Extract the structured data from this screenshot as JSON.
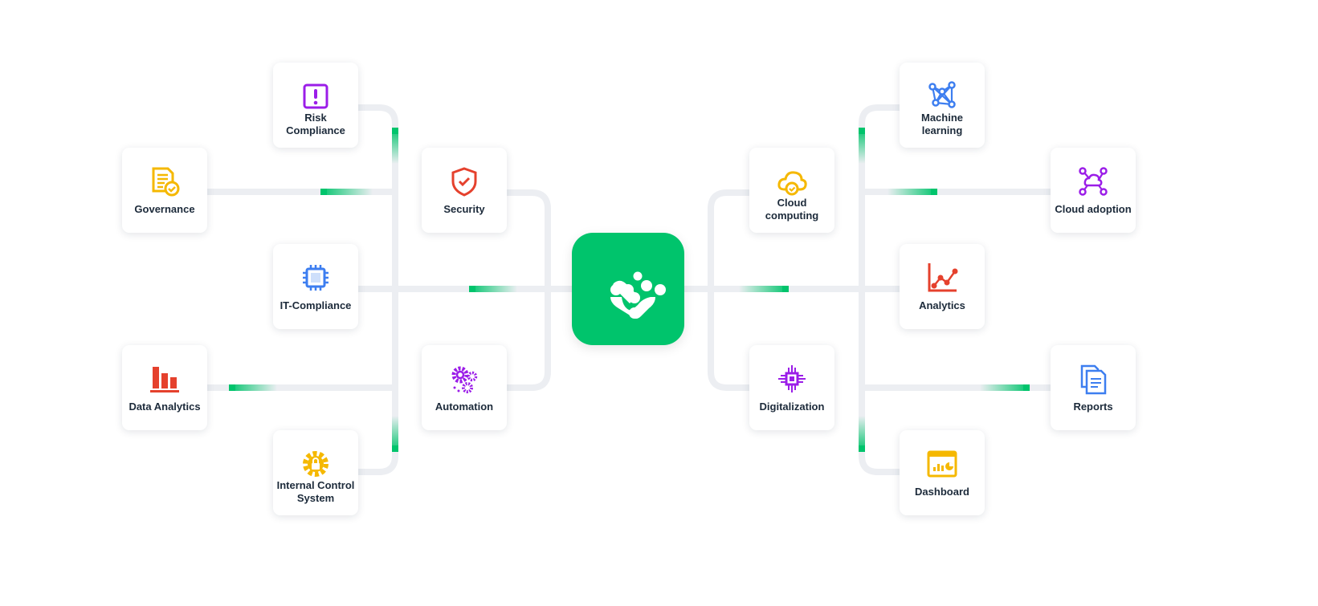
{
  "colors": {
    "line": "#eceef2",
    "accent": "#00c46c",
    "purple": "#9b1de8",
    "yellow": "#f5b800",
    "red": "#e5412d",
    "blue": "#3d7ef0"
  },
  "hub": {
    "icon": "brand-logo-icon"
  },
  "nodes": [
    {
      "id": "risk",
      "label": "Risk Compliance",
      "icon": "alert-box-icon"
    },
    {
      "id": "governance",
      "label": "Governance",
      "icon": "document-check-icon"
    },
    {
      "id": "security",
      "label": "Security",
      "icon": "shield-check-icon"
    },
    {
      "id": "it",
      "label": "IT-Compliance",
      "icon": "cpu-chip-icon"
    },
    {
      "id": "data",
      "label": "Data Analytics",
      "icon": "bar-chart-icon"
    },
    {
      "id": "automation",
      "label": "Automation",
      "icon": "gears-icon"
    },
    {
      "id": "ics",
      "label": "Internal Control System",
      "icon": "gear-lock-icon"
    },
    {
      "id": "cloudcomp",
      "label": "Cloud computing",
      "icon": "cloud-check-icon"
    },
    {
      "id": "digital",
      "label": "Digitalization",
      "icon": "circuit-chip-icon"
    },
    {
      "id": "ml",
      "label": "Machine learning",
      "icon": "neural-network-icon"
    },
    {
      "id": "cloudadopt",
      "label": "Cloud adoption",
      "icon": "cloud-network-icon"
    },
    {
      "id": "analytics",
      "label": "Analytics",
      "icon": "line-chart-icon"
    },
    {
      "id": "reports",
      "label": "Reports",
      "icon": "documents-icon"
    },
    {
      "id": "dashboard",
      "label": "Dashboard",
      "icon": "dashboard-window-icon"
    }
  ]
}
